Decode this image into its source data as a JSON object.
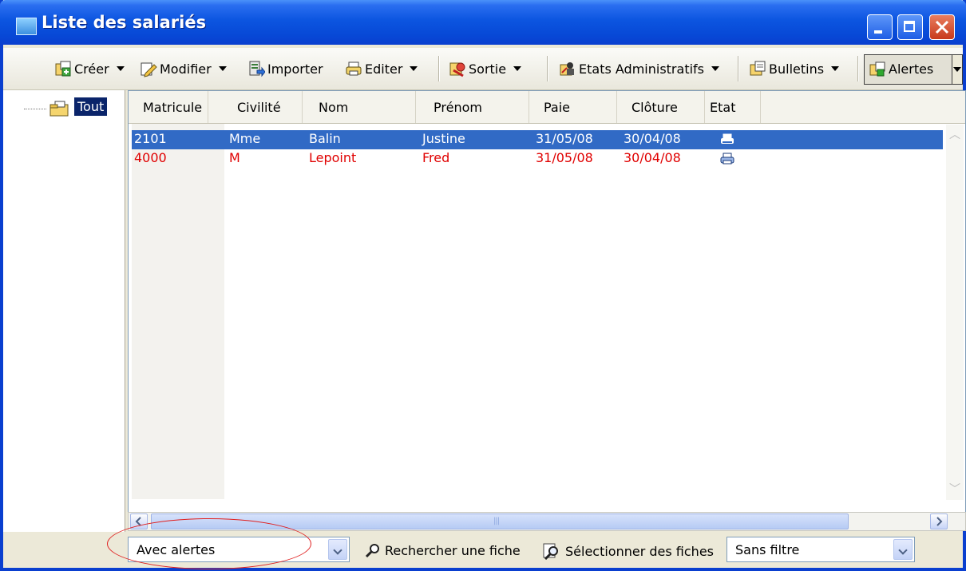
{
  "window": {
    "title": "Liste des salariés"
  },
  "toolbar": {
    "items": [
      {
        "label": "Créer",
        "icon": "create-icon",
        "has_menu": true
      },
      {
        "label": "Modifier",
        "icon": "edit-icon",
        "has_menu": true
      },
      {
        "label": "Importer",
        "icon": "import-icon",
        "has_menu": false
      },
      {
        "label": "Editer",
        "icon": "print-icon",
        "has_menu": true
      },
      {
        "label": "Sortie",
        "icon": "exit-icon",
        "has_menu": true
      },
      {
        "label": "Etats Administratifs",
        "icon": "admin-reports-icon",
        "has_menu": true
      },
      {
        "label": "Bulletins",
        "icon": "payslip-icon",
        "has_menu": true
      },
      {
        "label": "Alertes",
        "icon": "alerts-icon",
        "has_menu": true
      }
    ]
  },
  "tree": {
    "root_label": "Tout"
  },
  "grid": {
    "columns": [
      "Matricule",
      "Civilité",
      "Nom",
      "Prénom",
      "Paie",
      "Clôture",
      "Etat"
    ],
    "rows": [
      {
        "matricule": "2101",
        "civilite": "Mme",
        "nom": "Balin",
        "prenom": "Justine",
        "paie": "31/05/08",
        "cloture": "30/04/08",
        "etat_icon": "printer-icon",
        "selected": true
      },
      {
        "matricule": "4000",
        "civilite": "M",
        "nom": "Lepoint",
        "prenom": "Fred",
        "paie": "31/05/08",
        "cloture": "30/04/08",
        "etat_icon": "printer-icon",
        "alert": true
      }
    ]
  },
  "bottom": {
    "filter_value": "Avec alertes",
    "search_label": "Rechercher une fiche",
    "select_label": "Sélectionner des fiches",
    "filter2_value": "Sans filtre"
  },
  "colors": {
    "titlebar": "#0a3fcf",
    "selection": "#316ac5",
    "alert_text": "#e00000",
    "annotation": "#e02020"
  }
}
